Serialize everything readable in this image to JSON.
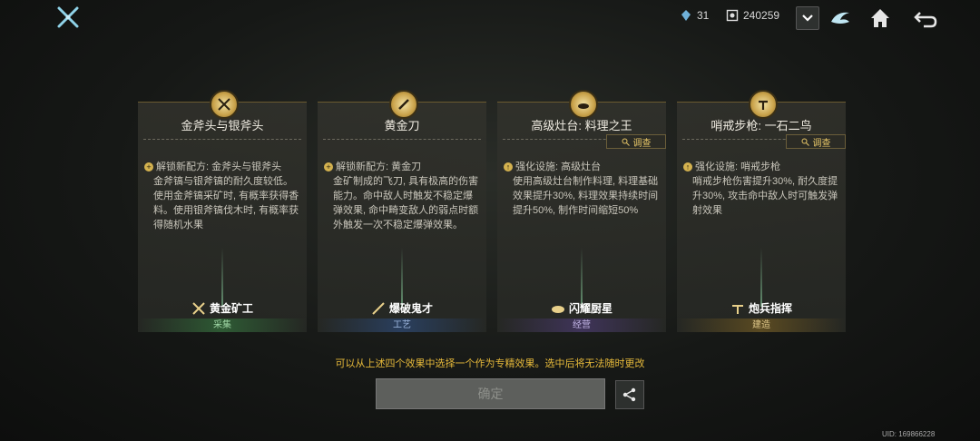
{
  "header": {
    "resource_a": "31",
    "resource_b": "240259",
    "icons": [
      "game-logo-icon",
      "crystal-icon",
      "coin-icon",
      "chevron-down-icon",
      "dragon-emblem-icon",
      "home-icon",
      "back-icon"
    ]
  },
  "cards": [
    {
      "title": "金斧头与银斧头",
      "has_investigate": false,
      "head": "解锁新配方: 金斧头与银斧头",
      "desc": "金斧镐与银斧镐的耐久度较低。使用金斧镐采矿时, 有概率获得香料。使用银斧镐伐木时, 有概率获得随机水果",
      "badge": "黄金矿工",
      "category": "采集",
      "category_color": "#2e5a34",
      "icon": "crossed-pickaxes-icon"
    },
    {
      "title": "黄金刀",
      "has_investigate": false,
      "head": "解锁新配方: 黄金刀",
      "desc": "金矿制成的飞刀, 具有极高的伤害能力。命中敌人时触发不稳定爆弹效果, 命中畸变敌人的弱点时额外触发一次不稳定爆弹效果。",
      "badge": "爆破鬼才",
      "category": "工艺",
      "category_color": "#2a3f5e",
      "icon": "knife-icon"
    },
    {
      "title": "高级灶台: 料理之王",
      "has_investigate": true,
      "investigate_label": "调查",
      "head": "强化设施: 高级灶台",
      "desc": "使用高级灶台制作料理, 料理基础效果提升30%, 料理效果持续时间提升50%, 制作时间缩短50%",
      "badge": "闪耀厨星",
      "category": "经营",
      "category_color": "#3f3459",
      "icon": "cooking-pot-icon"
    },
    {
      "title": "哨戒步枪: 一石二鸟",
      "has_investigate": true,
      "investigate_label": "调查",
      "head": "强化设施: 哨戒步枪",
      "desc": "哨戒步枪伤害提升30%, 耐久度提升30%, 攻击命中敌人时可触发弹射效果",
      "badge": "炮兵指挥",
      "category": "建造",
      "category_color": "#5a4a22",
      "icon": "sentry-rifle-icon"
    }
  ],
  "notice": "可以从上述四个效果中选择一个作为专精效果。选中后将无法随时更改",
  "confirm_label": "确定",
  "uid": "UID: 169866228"
}
